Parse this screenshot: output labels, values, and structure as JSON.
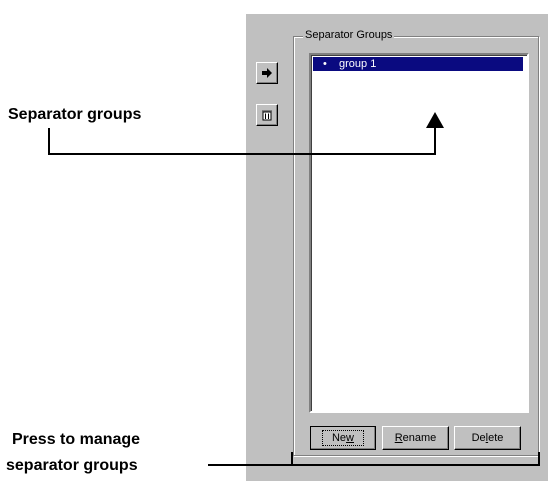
{
  "callouts": {
    "groups": "Separator groups",
    "manage_line1": "Press to manage",
    "manage_line2": "separator groups"
  },
  "toolbar": {
    "move_icon": "right-arrow-icon",
    "delete_icon": "trash-icon"
  },
  "groupbox": {
    "title": "Separator Groups",
    "items": [
      {
        "label": "group 1",
        "selected": true
      }
    ]
  },
  "buttons": {
    "new_label": "New",
    "rename_label": "Rename",
    "delete_label": "Delete"
  },
  "colors": {
    "dialog_bg": "#c0c0c0",
    "selection_bg": "#0a0a80",
    "selection_text": "#ffffff"
  }
}
